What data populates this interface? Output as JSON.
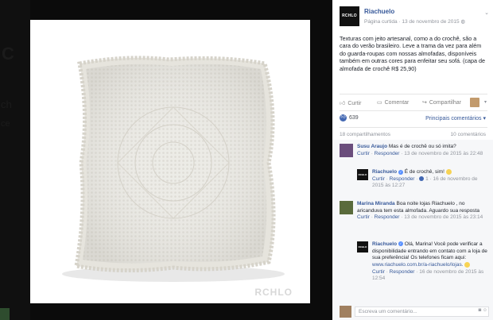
{
  "background_ghost": {
    "letter_c": "C",
    "fragment_ch": "ch",
    "fragment_ce": "ce"
  },
  "photo": {
    "watermark": "RCHLO",
    "description_icon": "crochet-pillow-image"
  },
  "post": {
    "page_logo": "RCHLO",
    "page_name": "Riachuelo",
    "page_type": "Página curtida",
    "date": "13 de novembro de 2015",
    "text": "Texturas com jeito artesanal, como a do crochê, são a cara do verão brasileiro. Leve a trama da vez para além do guarda-roupas com nossas almofadas, disponíveis também em outras cores para enfeitar seu sofá. (capa de almofada de crochê R$ 25,90)"
  },
  "actions": {
    "like": "Curtir",
    "comment": "Comentar",
    "share": "Compartilhar"
  },
  "reactions": {
    "count": "639",
    "sort_label": "Principais comentários"
  },
  "counts": {
    "shares": "18 compartilhamentos",
    "comments": "10 comentários"
  },
  "comments": [
    {
      "name": "Susu Araujo",
      "text": "Mas é de crochê ou só imita?",
      "like": "Curtir",
      "reply": "Responder",
      "time": "13 de novembro de 2015 às 22:48"
    },
    {
      "name": "Riachuelo",
      "text": "É de crochê, sim!",
      "like": "Curtir",
      "reply": "Responder",
      "likes": "1",
      "time": "16 de novembro de 2015 às 12:27"
    },
    {
      "name": "Marina Miranda",
      "text": "Boa noite lojas Riachuelo , no aricanduva tem esta almofada. Aguardo sua resposta",
      "like": "Curtir",
      "reply": "Responder",
      "time": "13 de novembro de 2015 às 23:14"
    },
    {
      "name": "Riachuelo",
      "text": "Olá, Marina! Você pode verificar a disponibilidade entrando em contato com a loja de sua preferência! Os telefones ficam aqui:",
      "link": "www.riachuelo.com.br/a-riachuelo/lojas.",
      "like": "Curtir",
      "reply": "Responder",
      "time": "16 de novembro de 2015 às 12:54"
    }
  ],
  "composer": {
    "placeholder": "Escreva um comentário..."
  },
  "colors": {
    "link": "#365899",
    "like_blue": "#4267b2",
    "muted": "#90949c"
  }
}
